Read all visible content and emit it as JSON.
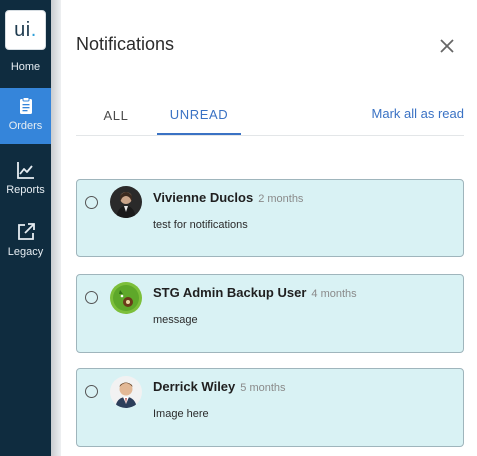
{
  "sidebar": {
    "logo": {
      "text": "ui",
      "dot": "."
    },
    "items": [
      {
        "label": "Home",
        "icon": "home",
        "active": false
      },
      {
        "label": "Orders",
        "icon": "clipboard-icon",
        "active": true
      },
      {
        "label": "Reports",
        "icon": "chart-icon",
        "active": false
      },
      {
        "label": "Legacy",
        "icon": "external-link-icon",
        "active": false
      }
    ]
  },
  "panel": {
    "title": "Notifications",
    "tabs": [
      {
        "label": "ALL",
        "active": false
      },
      {
        "label": "UNREAD",
        "active": true
      }
    ],
    "mark_all_label": "Mark all as read",
    "notifications": [
      {
        "name": "Vivienne Duclos",
        "time": "2 months",
        "message": "test for notifications",
        "avatar": "photo-woman"
      },
      {
        "name": "STG Admin Backup User",
        "time": "4 months",
        "message": "message",
        "avatar": "cartoon-green"
      },
      {
        "name": "Derrick Wiley",
        "time": "5 months",
        "message": "Image here",
        "avatar": "photo-man"
      }
    ]
  },
  "colors": {
    "sidebar_bg": "#0f2c3f",
    "active_nav": "#3585da",
    "accent": "#3a72c4",
    "card_bg": "#d9f2f4",
    "card_border": "#9fb5bc"
  }
}
